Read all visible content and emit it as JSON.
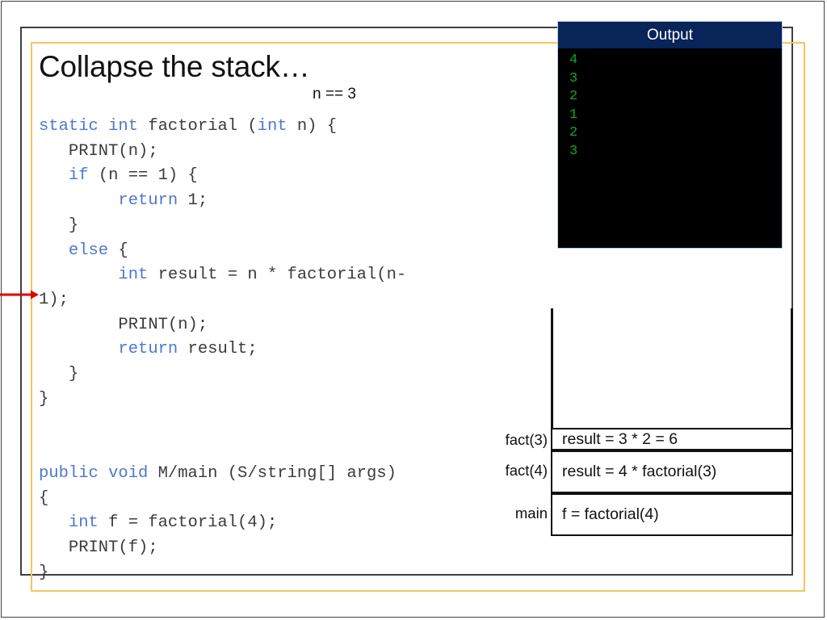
{
  "slide": {
    "title": "Collapse the stack…",
    "annotation": "n == 3"
  },
  "code": {
    "lines": [
      [
        {
          "t": "static int ",
          "k": true
        },
        {
          "t": "factorial (",
          "k": false
        },
        {
          "t": "int",
          "k": true
        },
        {
          "t": " n) {",
          "k": false
        }
      ],
      [
        {
          "t": "   PRINT(n);",
          "k": false
        }
      ],
      [
        {
          "t": "   ",
          "k": false
        },
        {
          "t": "if",
          "k": true
        },
        {
          "t": " (n == 1) {",
          "k": false
        }
      ],
      [
        {
          "t": "        ",
          "k": false
        },
        {
          "t": "return",
          "k": true
        },
        {
          "t": " 1;",
          "k": false
        }
      ],
      [
        {
          "t": "   }",
          "k": false
        }
      ],
      [
        {
          "t": "   ",
          "k": false
        },
        {
          "t": "else",
          "k": true
        },
        {
          "t": " {",
          "k": false
        }
      ],
      [
        {
          "t": "        ",
          "k": false
        },
        {
          "t": "int",
          "k": true
        },
        {
          "t": " result = n * factorial(n-",
          "k": false
        }
      ],
      [
        {
          "t": "1);",
          "k": false
        }
      ],
      [
        {
          "t": "        PRINT(n);",
          "k": false
        }
      ],
      [
        {
          "t": "        ",
          "k": false
        },
        {
          "t": "return",
          "k": true
        },
        {
          "t": " result;",
          "k": false
        }
      ],
      [
        {
          "t": "   }",
          "k": false
        }
      ],
      [
        {
          "t": "}",
          "k": false
        }
      ],
      [
        {
          "t": "",
          "k": false
        }
      ],
      [
        {
          "t": "",
          "k": false
        }
      ],
      [
        {
          "t": "public void",
          "k": true
        },
        {
          "t": " M/main (S/string[] args)",
          "k": false
        }
      ],
      [
        {
          "t": "{",
          "k": false
        }
      ],
      [
        {
          "t": "   ",
          "k": false
        },
        {
          "t": "int",
          "k": true
        },
        {
          "t": " f = factorial(4);",
          "k": false
        }
      ],
      [
        {
          "t": "   PRINT(f);",
          "k": false
        }
      ],
      [
        {
          "t": "}",
          "k": false
        }
      ]
    ]
  },
  "output_console": {
    "title": "Output",
    "lines": [
      "4",
      "3",
      "2",
      "1",
      "2",
      "3"
    ]
  },
  "call_stack": {
    "frames": [
      {
        "label": "fact(3)",
        "text": "result = 3 * 2 = 6"
      },
      {
        "label": "fact(4)",
        "text": "result = 4 * factorial(3)"
      },
      {
        "label": "main",
        "text": "f = factorial(4)"
      }
    ]
  },
  "icons": {
    "pointer_arrow": "red-right-arrow-icon"
  },
  "colors": {
    "keyword_blue": "#4f76cf",
    "console_green": "#13a528",
    "console_header_navy": "#082459",
    "frame_yellow": "#f2c75c",
    "frame_gray": "#3f3f3f",
    "arrow_red": "#e00000"
  }
}
